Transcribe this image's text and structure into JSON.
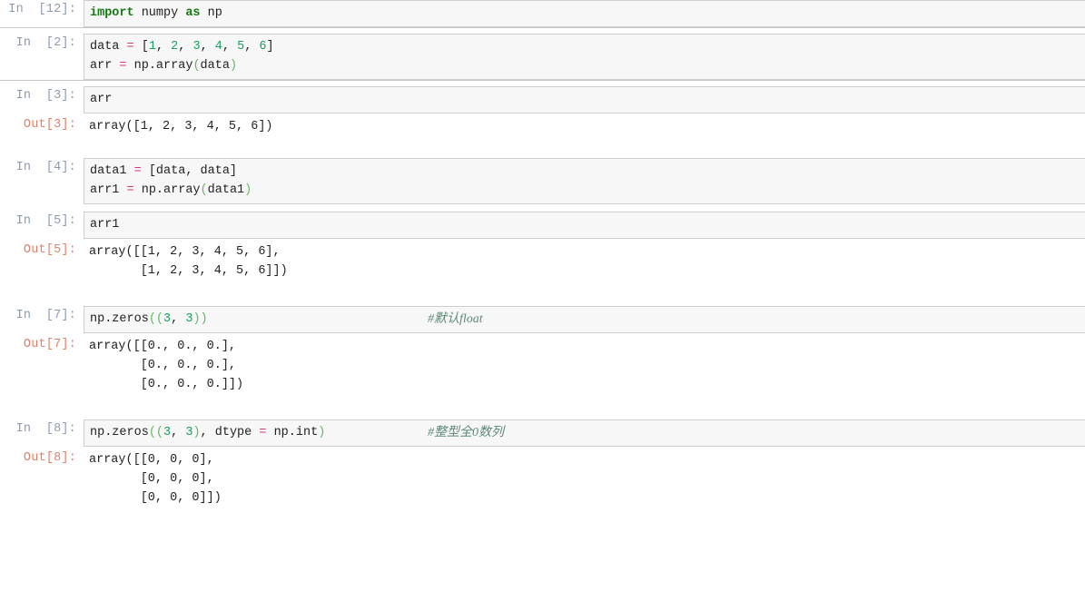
{
  "notebook": {
    "app": "jupyter-notebook",
    "prompt_in_label": "In",
    "prompt_out_label": "Out",
    "colors": {
      "input_background": "#f7f7f7",
      "input_border": "#cfcfcf",
      "prompt_in": "#8a9ab5",
      "prompt_out": "#d9836b",
      "keyword": "#137a13",
      "number": "#1a9e5f",
      "operator": "#d33682",
      "paren": "#62b862",
      "comment": "#5e8a77",
      "text": "#222222",
      "page_background": "#ffffff"
    },
    "cells": [
      {
        "id": "cell-1",
        "prompt_in": "In  [12]:",
        "code_lines": [
          [
            {
              "t": "import",
              "c": "kw"
            },
            {
              "t": " numpy ",
              "c": "plain"
            },
            {
              "t": "as",
              "c": "kw"
            },
            {
              "t": " np",
              "c": "plain"
            }
          ]
        ],
        "comment": "",
        "output": null
      },
      {
        "id": "cell-2",
        "prompt_in": "In  [2]:",
        "code_lines": [
          [
            {
              "t": "data ",
              "c": "plain"
            },
            {
              "t": "=",
              "c": "op"
            },
            {
              "t": " ",
              "c": "plain"
            },
            {
              "t": "[",
              "c": "plain"
            },
            {
              "t": "1",
              "c": "num"
            },
            {
              "t": ", ",
              "c": "plain"
            },
            {
              "t": "2",
              "c": "num"
            },
            {
              "t": ", ",
              "c": "plain"
            },
            {
              "t": "3",
              "c": "num"
            },
            {
              "t": ", ",
              "c": "plain"
            },
            {
              "t": "4",
              "c": "num"
            },
            {
              "t": ", ",
              "c": "plain"
            },
            {
              "t": "5",
              "c": "num"
            },
            {
              "t": ", ",
              "c": "plain"
            },
            {
              "t": "6",
              "c": "num"
            },
            {
              "t": "]",
              "c": "plain"
            }
          ],
          [
            {
              "t": "arr ",
              "c": "plain"
            },
            {
              "t": "=",
              "c": "op"
            },
            {
              "t": " np.array",
              "c": "plain"
            },
            {
              "t": "(",
              "c": "paren"
            },
            {
              "t": "data",
              "c": "plain"
            },
            {
              "t": ")",
              "c": "paren"
            }
          ]
        ],
        "comment": "",
        "output": null
      },
      {
        "id": "cell-3",
        "prompt_in": "In  [3]:",
        "code_lines": [
          [
            {
              "t": "arr",
              "c": "plain"
            }
          ]
        ],
        "comment": "",
        "output": {
          "prompt_out": "Out[3]:",
          "lines": [
            "array([1, 2, 3, 4, 5, 6])"
          ]
        }
      },
      {
        "id": "cell-4",
        "prompt_in": "In  [4]:",
        "code_lines": [
          [
            {
              "t": "data1 ",
              "c": "plain"
            },
            {
              "t": "=",
              "c": "op"
            },
            {
              "t": " [data, data]",
              "c": "plain"
            }
          ],
          [
            {
              "t": "arr1 ",
              "c": "plain"
            },
            {
              "t": "=",
              "c": "op"
            },
            {
              "t": " np.array",
              "c": "plain"
            },
            {
              "t": "(",
              "c": "paren"
            },
            {
              "t": "data1",
              "c": "plain"
            },
            {
              "t": ")",
              "c": "paren"
            }
          ]
        ],
        "comment": "",
        "output": null
      },
      {
        "id": "cell-5",
        "prompt_in": "In  [5]:",
        "code_lines": [
          [
            {
              "t": "arr1",
              "c": "plain"
            }
          ]
        ],
        "comment": "",
        "output": {
          "prompt_out": "Out[5]:",
          "lines": [
            "array([[1, 2, 3, 4, 5, 6],",
            "       [1, 2, 3, 4, 5, 6]])"
          ]
        }
      },
      {
        "id": "cell-6",
        "prompt_in": "In  [7]:",
        "code_lines": [
          [
            {
              "t": "np.zeros",
              "c": "plain"
            },
            {
              "t": "((",
              "c": "paren"
            },
            {
              "t": "3",
              "c": "num"
            },
            {
              "t": ", ",
              "c": "plain"
            },
            {
              "t": "3",
              "c": "num"
            },
            {
              "t": "))",
              "c": "paren"
            }
          ]
        ],
        "comment": "#默认float",
        "output": {
          "prompt_out": "Out[7]:",
          "lines": [
            "array([[0., 0., 0.],",
            "       [0., 0., 0.],",
            "       [0., 0., 0.]])"
          ]
        }
      },
      {
        "id": "cell-7",
        "prompt_in": "In  [8]:",
        "code_lines": [
          [
            {
              "t": "np.zeros",
              "c": "plain"
            },
            {
              "t": "((",
              "c": "paren"
            },
            {
              "t": "3",
              "c": "num"
            },
            {
              "t": ", ",
              "c": "plain"
            },
            {
              "t": "3",
              "c": "num"
            },
            {
              "t": ")",
              "c": "paren"
            },
            {
              "t": ", dtype ",
              "c": "plain"
            },
            {
              "t": "=",
              "c": "op"
            },
            {
              "t": " np.int",
              "c": "plain"
            },
            {
              "t": ")",
              "c": "paren"
            }
          ]
        ],
        "comment": "#整型全0数列",
        "output": {
          "prompt_out": "Out[8]:",
          "lines": [
            "array([[0, 0, 0],",
            "       [0, 0, 0],",
            "       [0, 0, 0]])"
          ]
        }
      }
    ]
  }
}
